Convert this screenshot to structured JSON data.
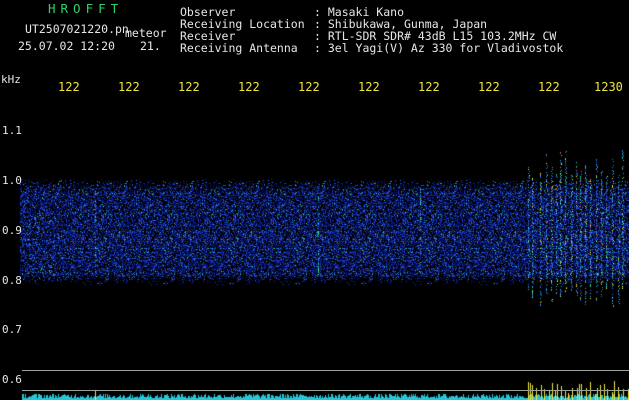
{
  "header": {
    "brand": "HROFFT",
    "filename": "UT2507021220.pn",
    "filename_suffix": "meteor",
    "datetime": "25.07.02 12:20",
    "count": "21."
  },
  "info": {
    "labels": [
      "Observer",
      "Receiving Location",
      "Receiver",
      "Receiving Antenna"
    ],
    "values": [
      ": Masaki Kano",
      ": Shibukawa, Gunma, Japan",
      ": RTL-SDR SDR# 43dB L15 103.2MHz CW",
      ": 3el Yagi(V) Az 330 for Vladivostok"
    ]
  },
  "axis": {
    "y_unit": "kHz",
    "y_ticks": [
      "1.1",
      "1.0",
      "0.9",
      "0.8",
      "0.7",
      "0.6"
    ],
    "x_ticks": [
      "122",
      "122",
      "122",
      "122",
      "122",
      "122",
      "122",
      "122",
      "122",
      "1230"
    ]
  },
  "colors": {
    "background": "#000000",
    "brand": "#2fd16a",
    "text": "#e6e6e6",
    "axis_labels": "#f0e63a",
    "signal_low": "#1a2a9a",
    "signal_high": "#f0e63a",
    "baseline": "#23c7d8"
  }
}
